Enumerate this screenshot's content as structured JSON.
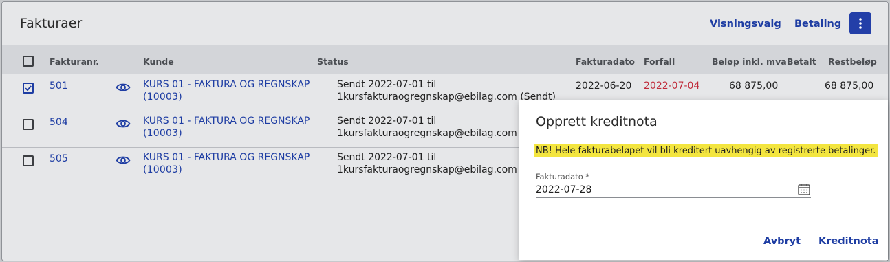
{
  "page": {
    "title": "Fakturaer"
  },
  "toolbar": {
    "view_options": "Visningsvalg",
    "payment": "Betaling",
    "more_icon": "more-vertical-icon"
  },
  "table": {
    "columns": [
      "Fakturanr.",
      "Kunde",
      "Status",
      "Fakturadato",
      "Forfall",
      "Beløp inkl. mva",
      "Betalt",
      "Restbeløp"
    ],
    "rows": [
      {
        "checked": true,
        "number": "501",
        "customer_line1": "KURS 01 - FAKTURA OG REGNSKAP",
        "customer_line2": "(10003)",
        "status_line1": "Sendt 2022-07-01 til",
        "status_line2": "1kursfakturaogregnskap@ebilag.com (Sendt)",
        "invoice_date": "2022-06-20",
        "due_date": "2022-07-04",
        "amount": "68 875,00",
        "paid": "",
        "remaining": "68 875,00"
      },
      {
        "checked": false,
        "number": "504",
        "customer_line1": "KURS 01 - FAKTURA OG REGNSKAP",
        "customer_line2": "(10003)",
        "status_line1": "Sendt 2022-07-01 til",
        "status_line2": "1kursfakturaogregnskap@ebilag.com (S"
      },
      {
        "checked": false,
        "number": "505",
        "customer_line1": "KURS 01 - FAKTURA OG REGNSKAP",
        "customer_line2": "(10003)",
        "status_line1": "Sendt 2022-07-01 til",
        "status_line2": "1kursfakturaogregnskap@ebilag.com (S"
      }
    ]
  },
  "dialog": {
    "title": "Opprett kreditnota",
    "warning": "NB! Hele fakturabeløpet vil bli kreditert uavhengig av registrerte betalinger.",
    "date_label": "Fakturadato *",
    "date_value": "2022-07-28",
    "cancel": "Avbryt",
    "confirm": "Kreditnota"
  },
  "colors": {
    "accent": "#1e3da3",
    "overdue": "#c02b3a",
    "warning_bg": "#f3e53f"
  }
}
